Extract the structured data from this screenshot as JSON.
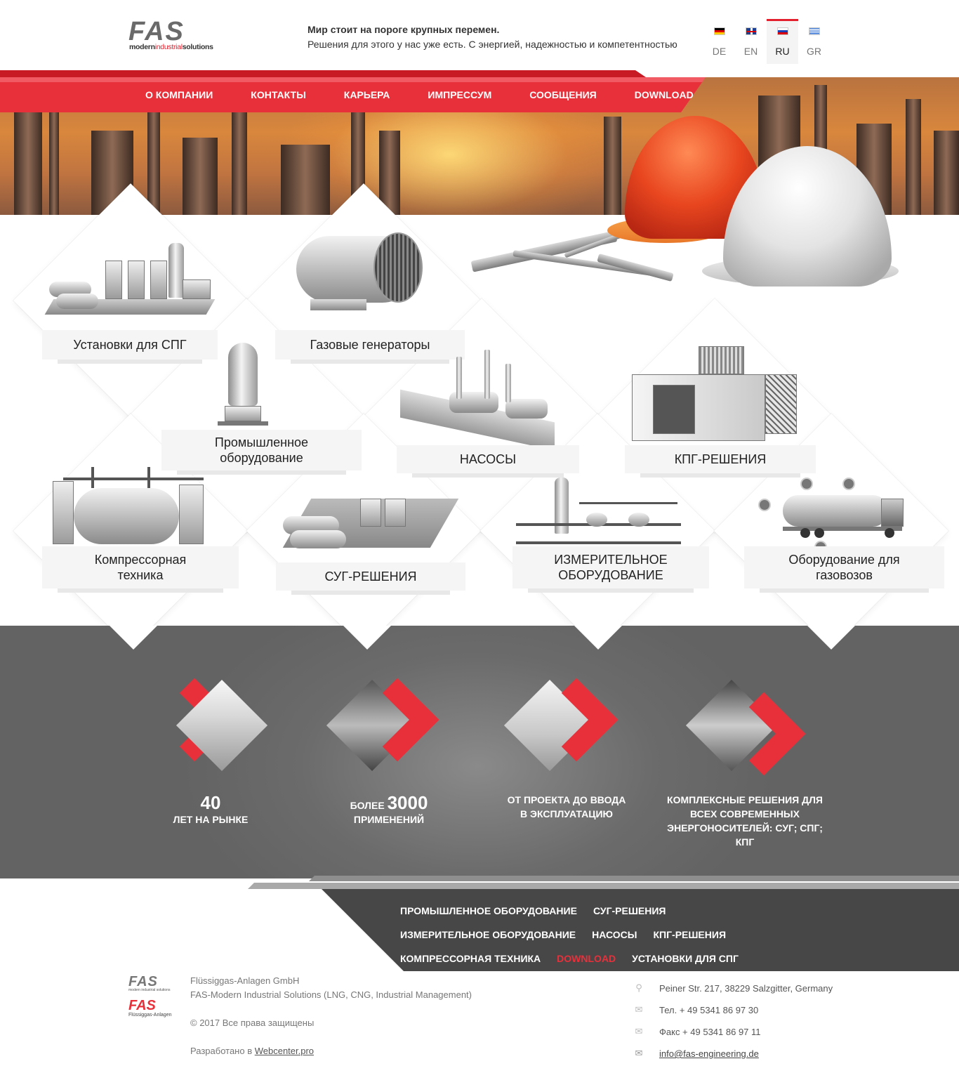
{
  "header": {
    "logo_mark": "FAS",
    "logo_sub_a": "modern",
    "logo_sub_b": "industrial",
    "logo_sub_c": "solutions",
    "tagline_bold": "Мир стоит на пороге крупных перемен.",
    "tagline": "Решения для этого у нас уже есть. С энергией, надежностью и компетентностью",
    "languages": [
      {
        "code": "DE",
        "flag": "germany-flag-icon"
      },
      {
        "code": "EN",
        "flag": "uk-flag-icon"
      },
      {
        "code": "RU",
        "flag": "russia-flag-icon",
        "active": true
      },
      {
        "code": "GR",
        "flag": "greece-flag-icon"
      }
    ]
  },
  "nav": {
    "items": [
      "О КОМПАНИИ",
      "КОНТАКТЫ",
      "КАРЬЕРА",
      "ИМПРЕССУМ",
      "СООБЩЕНИЯ",
      "DOWNLOAD"
    ]
  },
  "products": {
    "items": [
      {
        "label": "Установки для СПГ"
      },
      {
        "label": "Газовые генераторы"
      },
      {
        "label": "Промышленное оборудование"
      },
      {
        "label": "НАСОСЫ"
      },
      {
        "label": "КПГ-РЕШЕНИЯ"
      },
      {
        "label": "Компрессорная техника"
      },
      {
        "label": "СУГ-РЕШЕНИЯ"
      },
      {
        "label": "ИЗМЕРИТЕЛЬНОЕ ОБОРУДОВАНИЕ"
      },
      {
        "label": "Оборудование для газовозов"
      }
    ]
  },
  "stats": {
    "items": [
      {
        "big": "40",
        "text": "ЛЕТ НА РЫНКЕ"
      },
      {
        "prefix": "БОЛЕЕ",
        "big": "3000",
        "text": "ПРИМЕНЕНИЙ"
      },
      {
        "text": "ОТ ПРОЕКТА ДО ВВОДА В ЭКСПЛУАТАЦИЮ"
      },
      {
        "text": "КОМПЛЕКСНЫЕ РЕШЕНИЯ ДЛЯ ВСЕХ СОВРЕМЕННЫХ ЭНЕРГОНОСИТЕЛЕЙ: СУГ; СПГ; КПГ"
      }
    ]
  },
  "footer_links": {
    "row1": [
      "ПРОМЫШЛЕННОЕ ОБОРУДОВАНИЕ",
      "СУГ-РЕШЕНИЯ"
    ],
    "row2": [
      "ИЗМЕРИТЕЛЬНОЕ ОБОРУДОВАНИЕ",
      "НАСОСЫ",
      "КПГ-РЕШЕНИЯ"
    ],
    "row3": [
      "КОМПРЕССОРНАЯ ТЕХНИКА",
      "DOWNLOAD",
      "УСТАНОВКИ ДЛЯ СПГ"
    ]
  },
  "footer": {
    "logo1": "FAS",
    "logo1_sub": "modern industrial solutions",
    "logo2": "FAS",
    "logo2_sub": "Flüssiggas-Anlagen",
    "company": "Flüssiggas-Anlagen GmbH",
    "company_desc": "FAS-Modern Industrial Solutions (LNG, CNG, Industrial Management)",
    "copyright": "© 2017 Все права защищены",
    "dev_prefix": "Разработано в ",
    "dev_link": "Webcenter.pro",
    "address": "Peiner Str. 217, 38229 Salzgitter, Germany",
    "phone": "Тел. + 49 5341 86 97 30",
    "fax": "Факс + 49 5341 86 97 11",
    "email": "info@fas-engineering.de"
  },
  "colors": {
    "accent": "#e8303b",
    "dark_band": "#474747",
    "stats_bg": "#6b6b6b"
  }
}
